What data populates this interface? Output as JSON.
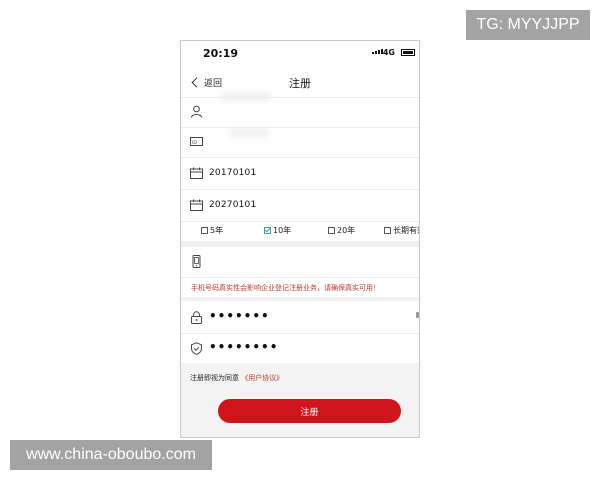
{
  "watermarks": {
    "top": "TG: MYYJJPP",
    "bottom": "www.china-oboubo.com"
  },
  "status_bar": {
    "time": "20:19",
    "network": "4G"
  },
  "nav": {
    "back_label": "返回",
    "title": "注册"
  },
  "form": {
    "name_value": "",
    "id_value": "",
    "start_date": "20170101",
    "end_date": "20270101",
    "period_options": [
      {
        "label": "5年",
        "checked": false
      },
      {
        "label": "10年",
        "checked": true
      },
      {
        "label": "20年",
        "checked": false
      },
      {
        "label": "长期有效",
        "checked": false
      }
    ],
    "phone_value": "",
    "phone_warning": "手机号码真实性会影响企业登记注册业务，请确保真实可用！",
    "password_value": "•••••••",
    "confirm_password_value": "••••••••"
  },
  "agreement": {
    "prefix": "注册即视为同意",
    "link": "《用户协议》"
  },
  "submit_label": "注册",
  "colors": {
    "brand_red": "#d0141c",
    "warning_red": "#c0392b",
    "check_teal": "#3aa0b0"
  },
  "icons": [
    "user-icon",
    "id-card-icon",
    "calendar-icon",
    "calendar-icon",
    "phone-icon",
    "lock-icon",
    "shield-lock-icon",
    "chevron-left-icon"
  ]
}
